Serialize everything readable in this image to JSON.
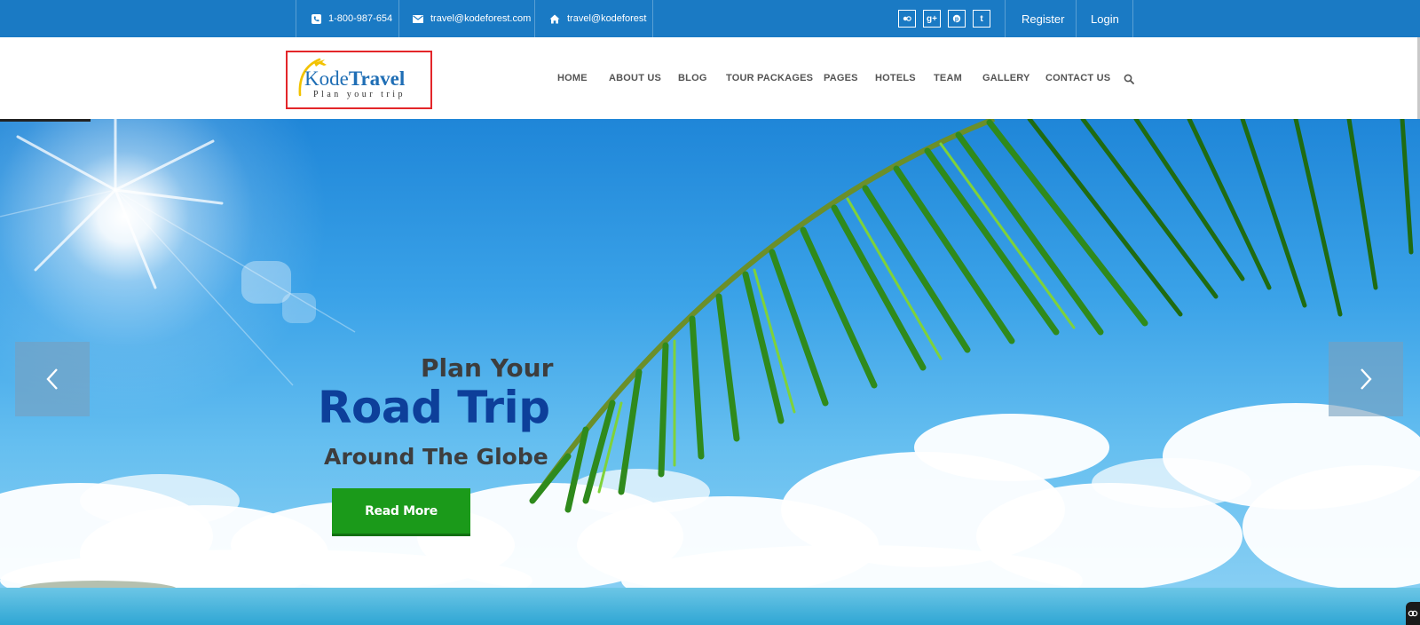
{
  "topbar": {
    "phone": "1-800-987-654",
    "email": "travel@kodeforest.com",
    "address": "travel@kodeforest",
    "social_icons": [
      "flickr-icon",
      "google-plus-icon",
      "pinterest-icon",
      "tumblr-icon"
    ],
    "social_glyphs": [
      "",
      "g+",
      "",
      "t"
    ],
    "register_label": "Register",
    "login_label": "Login",
    "bg_color": "#1a7ac4"
  },
  "header": {
    "logo": {
      "word_light": "Kode",
      "word_bold": "Travel",
      "tagline": "Plan your trip"
    },
    "nav": [
      {
        "label": "HOME"
      },
      {
        "label": "ABOUT US"
      },
      {
        "label": "BLOG"
      },
      {
        "label": "TOUR PACKAGES"
      },
      {
        "label": "PAGES"
      },
      {
        "label": "HOTELS"
      },
      {
        "label": "TEAM"
      },
      {
        "label": "GALLERY"
      },
      {
        "label": "CONTACT US"
      }
    ]
  },
  "hero": {
    "line1": "Plan Your",
    "line2": "Road Trip",
    "line3": "Around The Globe",
    "cta_label": "Read More",
    "cta_color": "#1b9a1a",
    "headline_color": "#0d3f9a"
  }
}
